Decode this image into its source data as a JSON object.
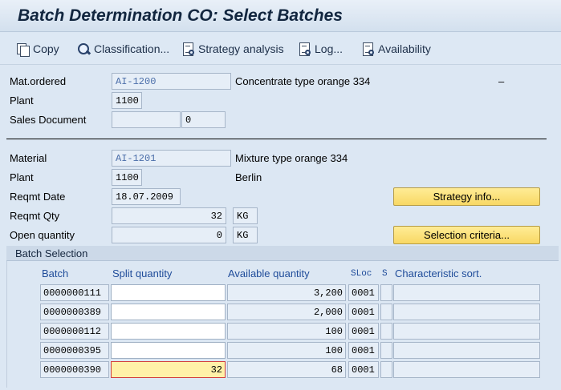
{
  "title": "Batch Determination CO: Select Batches",
  "toolbar": {
    "copy": "Copy",
    "classification": "Classification...",
    "strategy_analysis": "Strategy analysis",
    "log": "Log...",
    "availability": "Availability"
  },
  "header1": {
    "mat_ordered_label": "Mat.ordered",
    "mat_ordered_value": "AI-1200",
    "mat_ordered_desc": "Concentrate type orange 334",
    "mat_ordered_dash": "–",
    "plant_label": "Plant",
    "plant_value": "1100",
    "sales_doc_label": "Sales Document",
    "sales_doc_value": "",
    "sales_doc_item": "0"
  },
  "header2": {
    "material_label": "Material",
    "material_value": "AI-1201",
    "material_desc": "Mixture type orange 334",
    "plant_label": "Plant",
    "plant_value": "1100",
    "plant_desc": "Berlin",
    "reqmt_date_label": "Reqmt Date",
    "reqmt_date_value": "18.07.2009",
    "reqmt_qty_label": "Reqmt Qty",
    "reqmt_qty_value": "32",
    "reqmt_qty_unit": "KG",
    "open_qty_label": "Open quantity",
    "open_qty_value": "0",
    "open_qty_unit": "KG"
  },
  "buttons": {
    "strategy_info": "Strategy info...",
    "selection_criteria": "Selection criteria..."
  },
  "batch_selection": {
    "title": "Batch Selection",
    "columns": {
      "batch": "Batch",
      "split_qty": "Split quantity",
      "avail_qty": "Available quantity",
      "sloc": "SLoc",
      "s": "S",
      "char_sort": "Characteristic sort."
    },
    "rows": [
      {
        "batch": "0000000111",
        "split": "",
        "avail": "3,200",
        "sloc": "0001",
        "s": "",
        "char": ""
      },
      {
        "batch": "0000000389",
        "split": "",
        "avail": "2,000",
        "sloc": "0001",
        "s": "",
        "char": ""
      },
      {
        "batch": "0000000112",
        "split": "",
        "avail": "100",
        "sloc": "0001",
        "s": "",
        "char": ""
      },
      {
        "batch": "0000000395",
        "split": "",
        "avail": "100",
        "sloc": "0001",
        "s": "",
        "char": ""
      },
      {
        "batch": "0000000390",
        "split": "32",
        "avail": "68",
        "sloc": "0001",
        "s": "",
        "char": ""
      }
    ]
  }
}
